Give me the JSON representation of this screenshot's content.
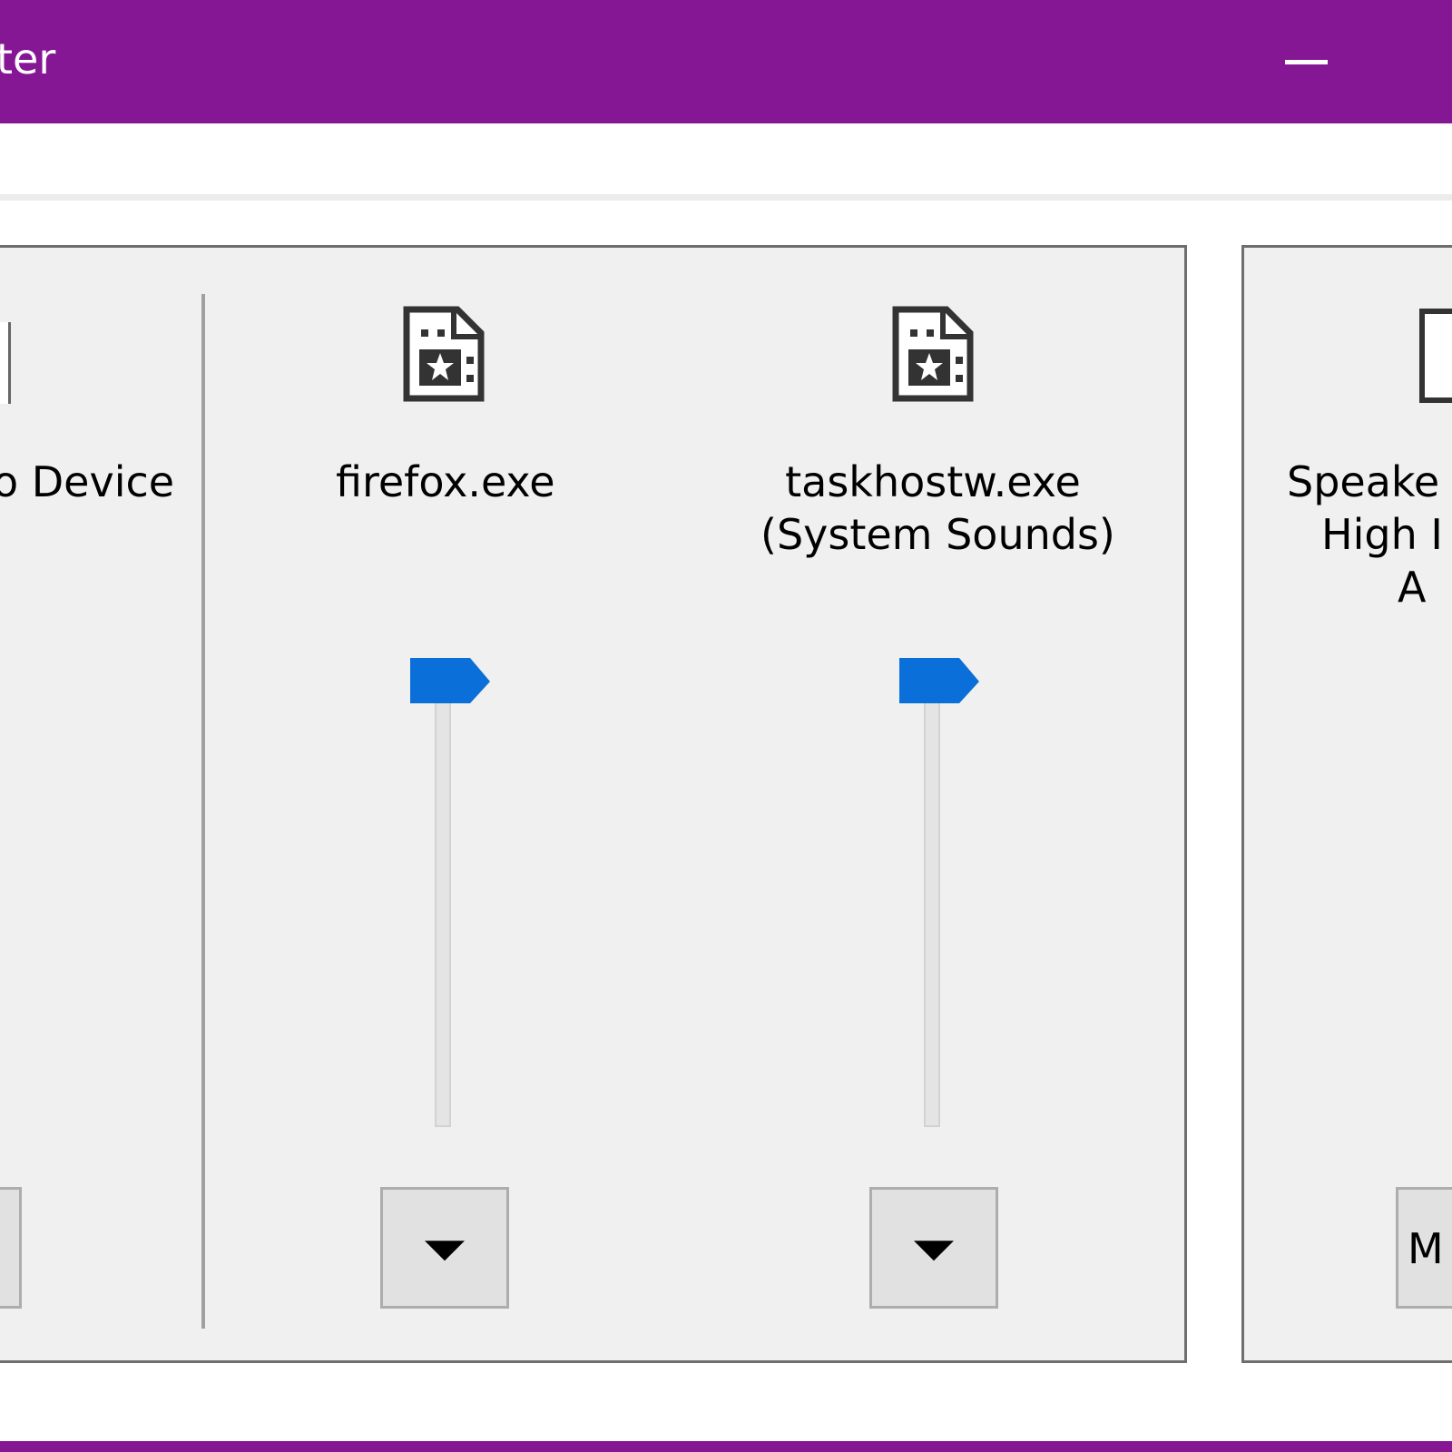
{
  "window": {
    "title": "ter",
    "accent": "#861794",
    "minimize_icon": "minimize-icon"
  },
  "applications_group": {
    "left_partial": {
      "label": "o Device",
      "button_partial_icon": "dropdown-button"
    },
    "apps": [
      {
        "name": "firefox.exe",
        "icon": "app-document-icon",
        "volume_percent": 100,
        "dropdown_icon": "caret-down-icon"
      },
      {
        "name_line1": "taskhostw.exe",
        "name_line2": "(System Sounds)",
        "icon": "app-document-icon",
        "volume_percent": 100,
        "dropdown_icon": "caret-down-icon"
      }
    ]
  },
  "device_group": {
    "label_line1": "Speake",
    "label_line2": "High I",
    "label_line3": "A",
    "button_label": "M"
  },
  "colors": {
    "slider_thumb": "#0a6fd8",
    "panel_bg": "#f0f0f0"
  }
}
